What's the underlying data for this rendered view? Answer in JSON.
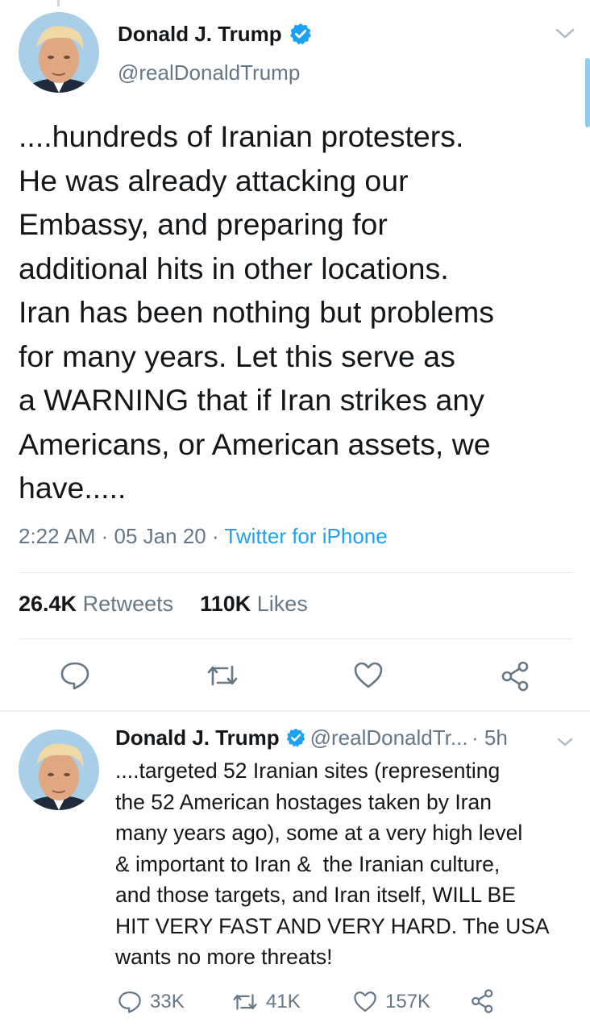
{
  "main_tweet": {
    "name": "Donald J. Trump",
    "handle": "@realDonaldTrump",
    "text": "....hundreds of Iranian protesters.\nHe was already attacking our\nEmbassy, and preparing for\nadditional hits in other locations.\nIran has been nothing but problems\nfor many years. Let this serve as\na WARNING that if Iran strikes any\nAmericans, or American assets, we\nhave.....",
    "time": "2:22 AM",
    "date": "05 Jan 20",
    "source": "Twitter for iPhone",
    "retweets_count": "26.4K",
    "retweets_label": "Retweets",
    "likes_count": "110K",
    "likes_label": "Likes",
    "actions": [
      "reply-icon",
      "retweet-icon",
      "like-icon",
      "share-icon"
    ]
  },
  "reply_tweet": {
    "name": "Donald J. Trump",
    "handle": "@realDonaldTr...",
    "time_ago": "5h",
    "text": "....targeted 52 Iranian sites (representing\nthe 52 American hostages taken by Iran\nmany years ago), some at a very high level\n& important to Iran &  the Iranian culture,\nand those targets, and Iran itself, WILL BE\nHIT VERY FAST AND VERY HARD. The USA\nwants no more threats!",
    "reply_count": "33K",
    "retweet_count": "41K",
    "like_count": "157K"
  },
  "colors": {
    "accent": "#1da1f2",
    "secondary_text": "#657786",
    "divider": "#e1e8ed"
  }
}
